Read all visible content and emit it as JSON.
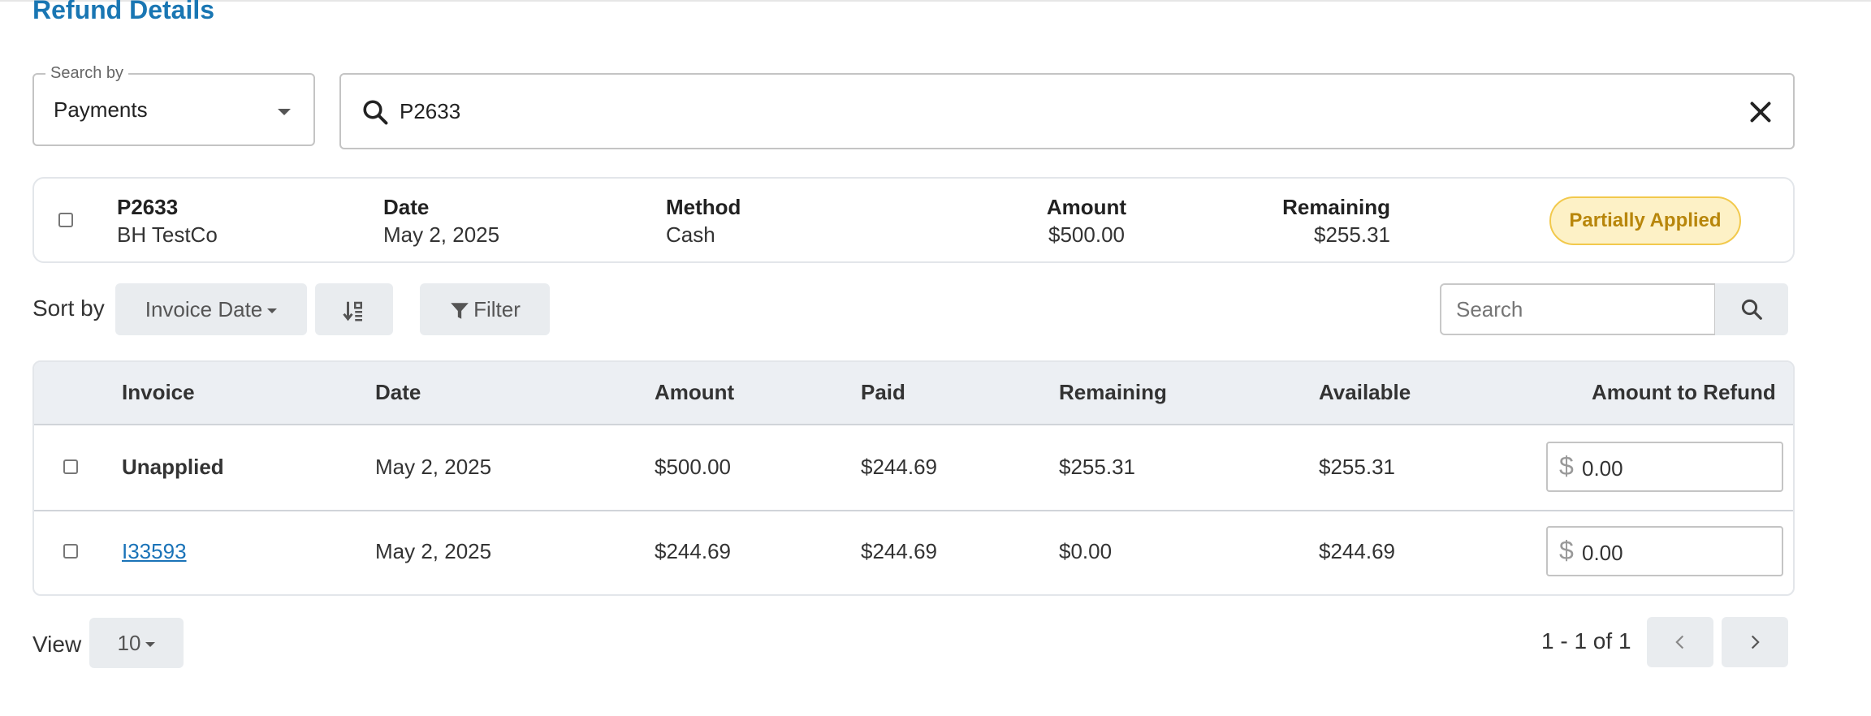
{
  "page": {
    "title": "Refund Details"
  },
  "search_by": {
    "label": "Search by",
    "value": "Payments"
  },
  "search": {
    "value": "P2633"
  },
  "payment": {
    "id": "P2633",
    "customer": "BH TestCo",
    "date_label": "Date",
    "date": "May 2, 2025",
    "method_label": "Method",
    "method": "Cash",
    "amount_label": "Amount",
    "amount": "$500.00",
    "remaining_label": "Remaining",
    "remaining": "$255.31",
    "status": "Partially Applied"
  },
  "toolbar": {
    "sort_label": "Sort by",
    "sort_value": "Invoice Date",
    "filter_label": "Filter",
    "search_placeholder": "Search"
  },
  "table": {
    "columns": [
      "Invoice",
      "Date",
      "Amount",
      "Paid",
      "Remaining",
      "Available",
      "Amount to Refund"
    ],
    "rows": [
      {
        "invoice": "Unapplied",
        "date": "May 2, 2025",
        "amount": "$500.00",
        "paid": "$244.69",
        "remaining": "$255.31",
        "available": "$255.31",
        "refund_currency": "$",
        "refund": "0.00"
      },
      {
        "invoice": "I33593",
        "date": "May 2, 2025",
        "amount": "$244.69",
        "paid": "$244.69",
        "remaining": "$0.00",
        "available": "$244.69",
        "refund_currency": "$",
        "refund": "0.00"
      }
    ]
  },
  "footer": {
    "view_label": "View",
    "page_size": "10",
    "range": "1 - 1 of 1"
  },
  "colors": {
    "accent": "#1976b3",
    "badge_bg": "#fdf1c6",
    "badge_text": "#b8860b",
    "link": "#1a73b8"
  }
}
